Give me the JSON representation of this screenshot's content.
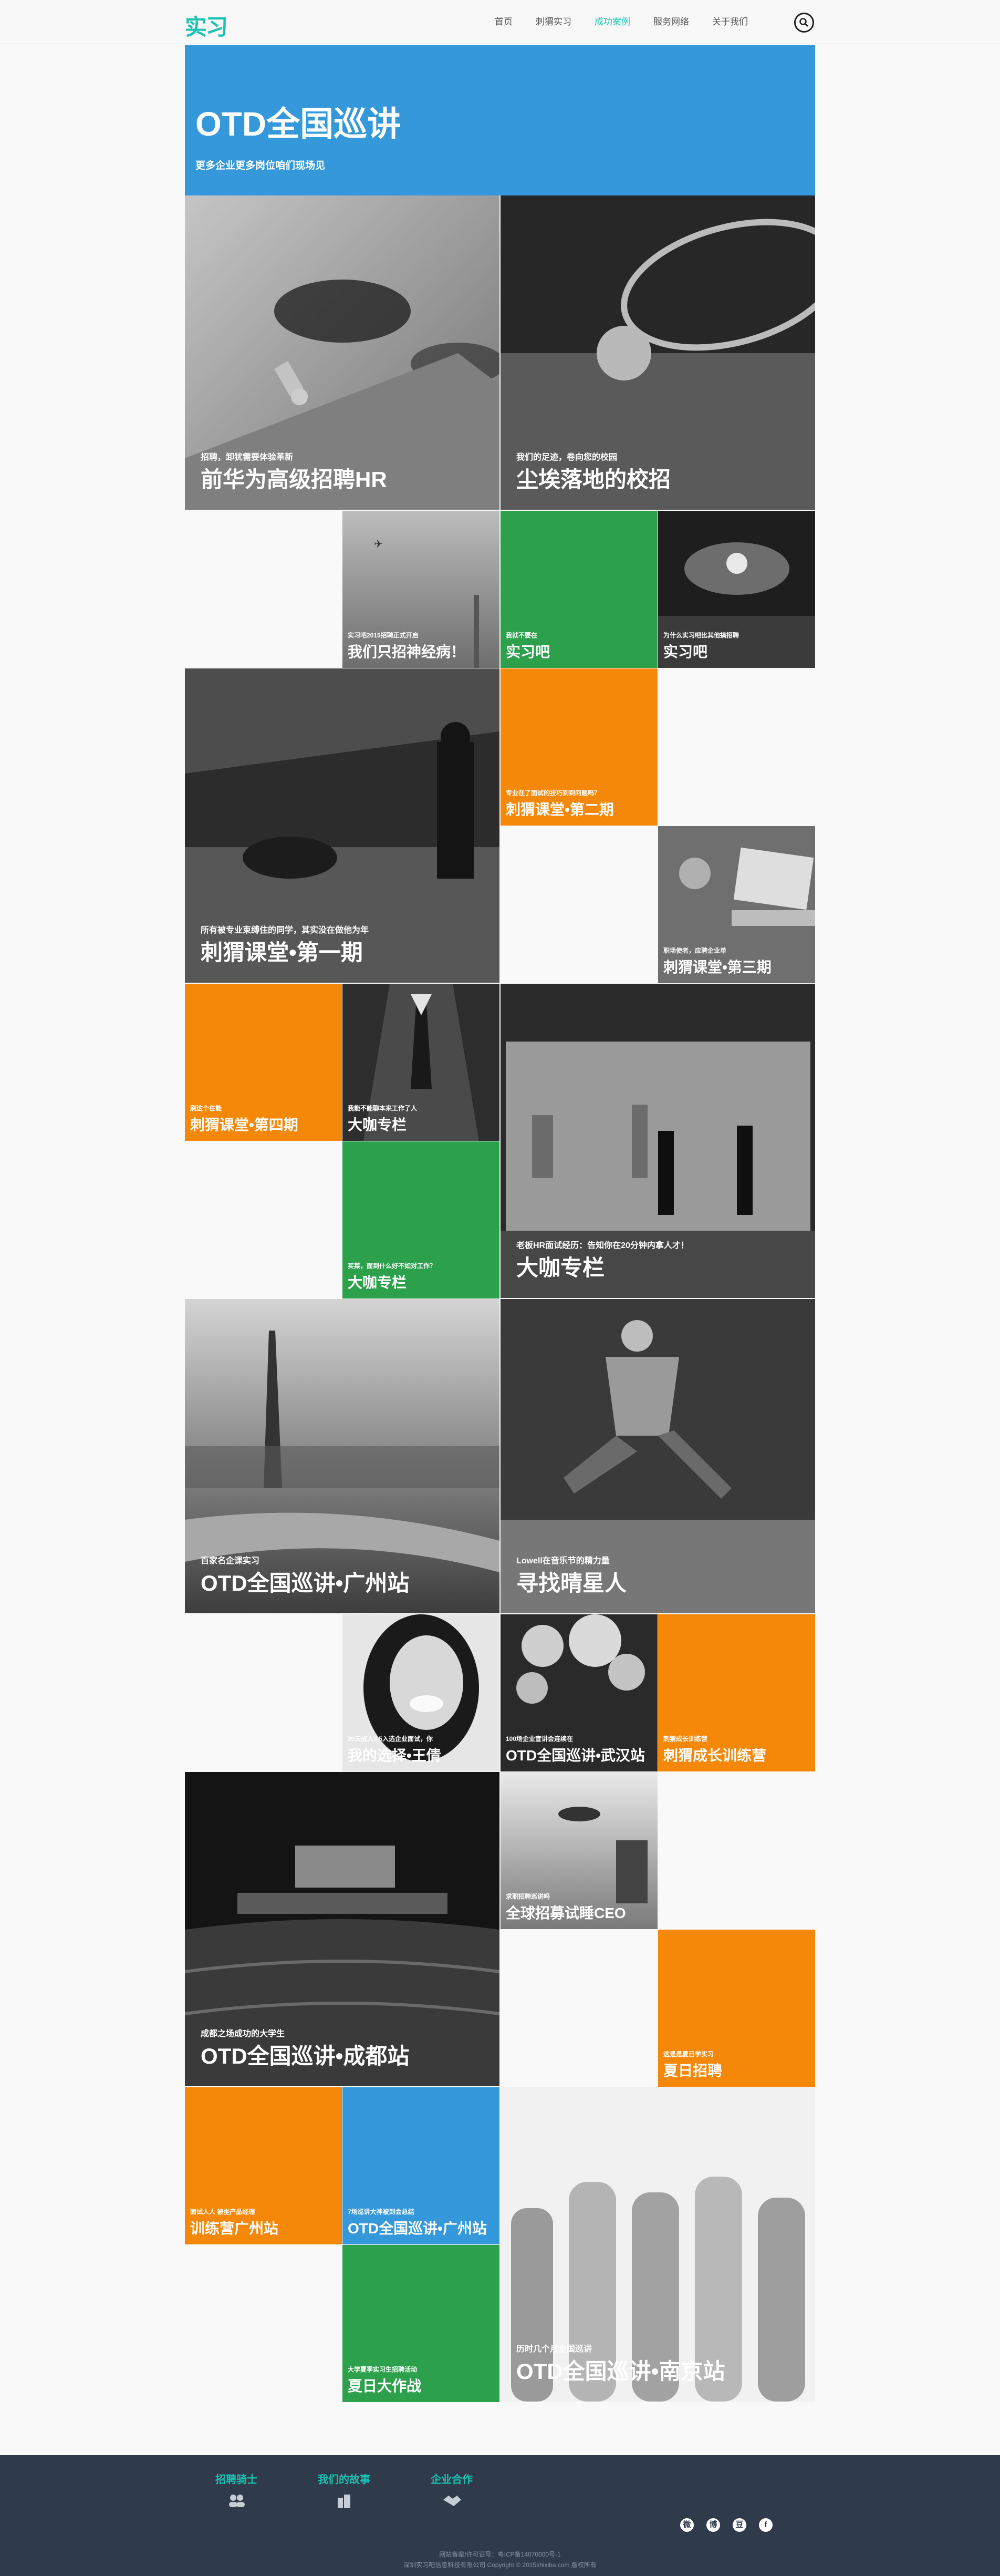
{
  "header": {
    "logo": "实习吧",
    "nav": [
      "首页",
      "刺猬实习",
      "成功案例",
      "服务网络",
      "关于我们"
    ],
    "active_nav": "成功案例"
  },
  "hero": {
    "title": "OTD全国巡讲",
    "subtitle": "更多企业更多岗位咱们现场见"
  },
  "tiles": [
    {
      "sub": "招聘，卸犹需要体验革新",
      "title": "前华为高级招聘HR"
    },
    {
      "sub": "我们的足迹，卷向您的校园",
      "title": "尘埃落地的校招"
    },
    {
      "sub": "实习吧2015招聘正式开启",
      "title": "我们只招神经病！"
    },
    {
      "sub": "我就不要在",
      "title": "实习吧"
    },
    {
      "sub": "为什么实习吧比其他搞招聘",
      "title": "实习吧"
    },
    {
      "sub": "所有被专业束缚住的同学，其实没在做他为年",
      "title": "刺猬课堂•第一期"
    },
    {
      "sub": "专业在了面试的技巧到到问题吗？",
      "title": "刺猬课堂•第二期"
    },
    {
      "sub": "职场使者，应聘企业单",
      "title": "刺猬课堂•第三期"
    },
    {
      "sub": "刷这个在能",
      "title": "刺猬课堂•第四期"
    },
    {
      "sub": "我能不能聊本来工作了人",
      "title": "大咖专栏"
    },
    {
      "sub": "买菜，面到什么好不如对工作？",
      "title": "大咖专栏"
    },
    {
      "sub": "老板HR面试经历：告知你在20分钟内拿人才！",
      "title": "大咖专栏"
    },
    {
      "sub": "百家名企课实习",
      "title": "OTD全国巡讲•广州站"
    },
    {
      "sub": "Lowell在音乐节的精力量",
      "title": "寻找晴星人"
    },
    {
      "sub": "20天成人3.5入选企业面试，你",
      "title": "我的选择•王倩"
    },
    {
      "sub": "100场企业宣讲会连续在",
      "title": "OTD全国巡讲•武汉站"
    },
    {
      "sub": "刺猬成长训练营",
      "title": "刺猬成长训练营"
    },
    {
      "sub": "求职招聘巡讲吗",
      "title": "全球招募试睡CEO"
    },
    {
      "sub": "成都之场成功的大学生",
      "title": "OTD全国巡讲•成都站"
    },
    {
      "sub": "这是是夏日学实习",
      "title": "夏日招聘"
    },
    {
      "sub": "面试人人 被坐产品经理",
      "title": "训练营广州站"
    },
    {
      "sub": "7场巡讲大神被到会总结",
      "title": "OTD全国巡讲•广州站"
    },
    {
      "sub": "大学夏季实习生招聘活动",
      "title": "夏日大作战"
    },
    {
      "sub": "历时几个月全国巡讲",
      "title": "OTD全国巡讲•南京站"
    }
  ],
  "footer": {
    "links": [
      "招聘骑士",
      "我们的故事",
      "企业合作"
    ],
    "social": [
      "微",
      "博",
      "豆",
      "f"
    ],
    "line1": "网站备案/许可证号：粤ICP备14070000号-1",
    "line2": "深圳实习吧信息科技有限公司 Copyright © 2015shixiba.com 版权所有"
  },
  "colors": {
    "accent": "#19c3b4",
    "blue": "#3498db",
    "orange": "#f58709",
    "green": "#2ca04b",
    "footer": "#2f3a4b"
  }
}
